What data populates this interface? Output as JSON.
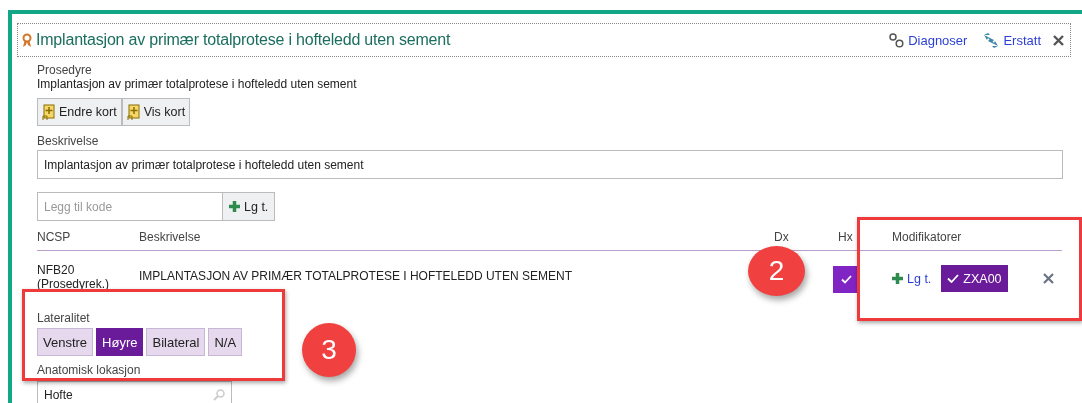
{
  "panel": {
    "title": "Implantasjon av primær totalprotese i hofteledd uten sement",
    "links": [
      {
        "kind": "diagnoses",
        "label": "Diagnoser"
      },
      {
        "kind": "replace",
        "label": "Erstatt"
      }
    ]
  },
  "procedure": {
    "label": "Prosedyre",
    "value": "Implantasjon av primær totalprotese i hofteledd uten sement"
  },
  "card_buttons": [
    "Endre kort",
    "Vis kort"
  ],
  "description": {
    "label": "Beskrivelse",
    "value": "Implantasjon av primær totalprotese i hofteledd uten sement"
  },
  "add_code": {
    "placeholder": "Legg til kode",
    "button": "Lg t."
  },
  "table": {
    "columns": [
      "NCSP",
      "Beskrivelse",
      "Dx",
      "Hx",
      "Modifikatorer"
    ],
    "rows": [
      {
        "code": "NFB20",
        "code_type": "(Prosedyrek.)",
        "description": "IMPLANTASJON AV PRIMÆR TOTALPROTESE I HOFTELEDD UTEN SEMENT",
        "hx_checked": true,
        "modifier_add": "Lg t.",
        "modifiers": [
          {
            "label": "ZXA00",
            "selected": true
          }
        ]
      }
    ]
  },
  "laterality": {
    "label": "Lateralitet",
    "options": [
      {
        "label": "Venstre",
        "selected": false
      },
      {
        "label": "Høyre",
        "selected": true
      },
      {
        "label": "Bilateral",
        "selected": false
      },
      {
        "label": "N/A",
        "selected": false
      }
    ]
  },
  "anatomic": {
    "label": "Anatomisk lokasjon",
    "value": "Hofte"
  },
  "annotations": [
    {
      "number": "2"
    },
    {
      "number": "3"
    }
  ]
}
